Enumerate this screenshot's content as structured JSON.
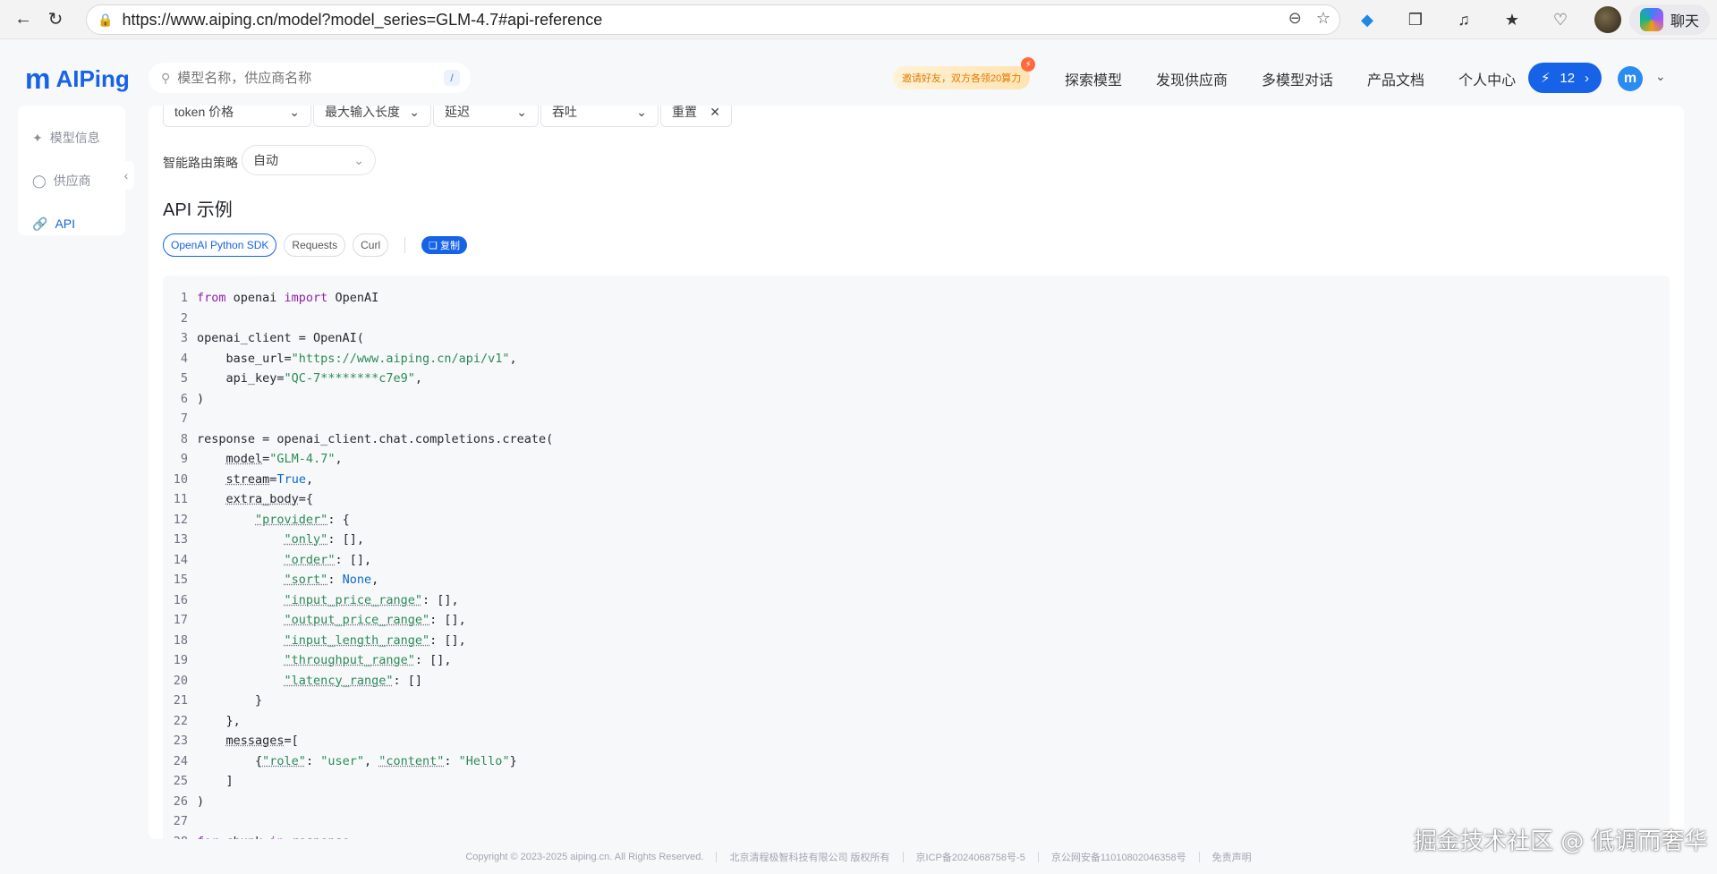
{
  "browser": {
    "url": "https://www.aiping.cn/model?model_series=GLM-4.7#api-reference",
    "chat_label": "聊天"
  },
  "header": {
    "logo_text": "AIPing",
    "search_placeholder": "模型名称，供应商名称",
    "search_shortcut": "/",
    "invite_text": "邀请好友，双方各领20算力",
    "nav": [
      "探索模型",
      "发现供应商",
      "多模型对话",
      "产品文档",
      "个人中心"
    ],
    "credits": "12",
    "avatar_letter": "m"
  },
  "sidebar": {
    "items": [
      {
        "label": "模型信息",
        "icon": "sparkle-icon"
      },
      {
        "label": "供应商",
        "icon": "robot-icon"
      },
      {
        "label": "API",
        "icon": "link-icon"
      }
    ]
  },
  "filters": {
    "items": [
      "token 价格",
      "最大输入长度",
      "延迟",
      "吞吐",
      "重置"
    ],
    "strategy_label": "智能路由策略",
    "strategy_value": "自动"
  },
  "api": {
    "title": "API 示例",
    "tabs": [
      "OpenAI Python SDK",
      "Requests",
      "Curl"
    ],
    "copy_label": "复制"
  },
  "footer": {
    "items": [
      "Copyright © 2023-2025 aiping.cn. All Rights Reserved.",
      "北京清程极智科技有限公司 版权所有",
      "京ICP备2024068758号-5",
      "京公网安备11010802046358号",
      "免责声明"
    ]
  },
  "watermark": "掘金技术社区 @ 低调而奢华"
}
